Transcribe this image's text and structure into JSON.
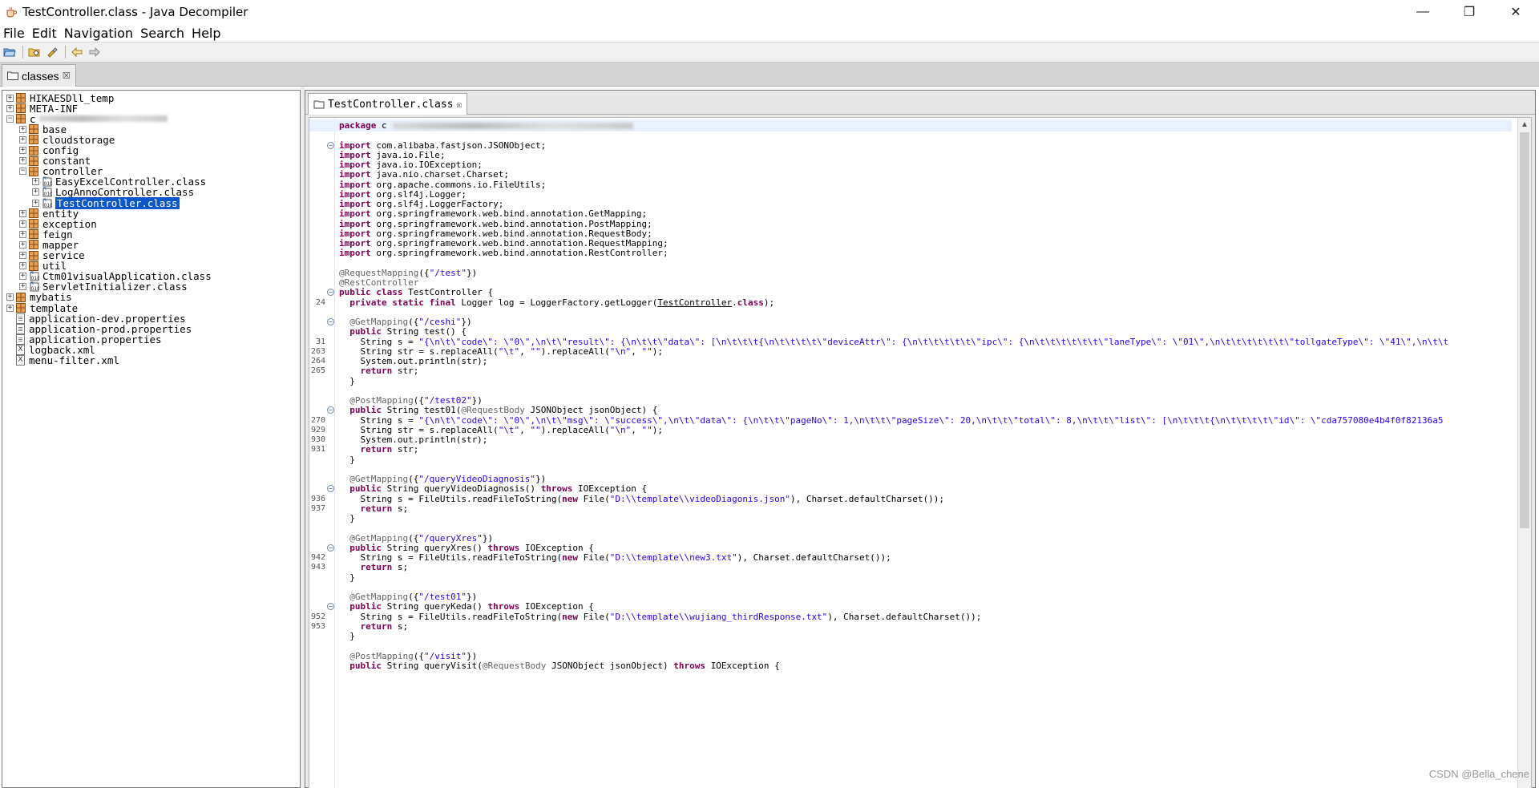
{
  "window": {
    "title": "TestController.class - Java Decompiler",
    "minimize": "—",
    "restore": "❐",
    "close": "✕"
  },
  "menu": [
    "File",
    "Edit",
    "Navigation",
    "Search",
    "Help"
  ],
  "outer_tab": {
    "label": "classes",
    "close": "☒"
  },
  "editor_tab": {
    "label": "TestController.class",
    "close": "☒"
  },
  "tree": {
    "items": [
      {
        "label": "HIKAESDll_temp",
        "indent": 0,
        "expander": "+",
        "icon": "package"
      },
      {
        "label": "META-INF",
        "indent": 0,
        "expander": "+",
        "icon": "package"
      },
      {
        "label": "c",
        "indent": 0,
        "expander": "-",
        "icon": "package",
        "redacted": true
      },
      {
        "label": "base",
        "indent": 1,
        "expander": "+",
        "icon": "package"
      },
      {
        "label": "cloudstorage",
        "indent": 1,
        "expander": "+",
        "icon": "package"
      },
      {
        "label": "config",
        "indent": 1,
        "expander": "+",
        "icon": "package"
      },
      {
        "label": "constant",
        "indent": 1,
        "expander": "+",
        "icon": "package"
      },
      {
        "label": "controller",
        "indent": 1,
        "expander": "-",
        "icon": "package"
      },
      {
        "label": "EasyExcelController.class",
        "indent": 2,
        "expander": "+",
        "icon": "class"
      },
      {
        "label": "LogAnnoController.class",
        "indent": 2,
        "expander": "+",
        "icon": "class"
      },
      {
        "label": "TestController.class",
        "indent": 2,
        "expander": "+",
        "icon": "class",
        "selected": true
      },
      {
        "label": "entity",
        "indent": 1,
        "expander": "+",
        "icon": "package"
      },
      {
        "label": "exception",
        "indent": 1,
        "expander": "+",
        "icon": "package"
      },
      {
        "label": "feign",
        "indent": 1,
        "expander": "+",
        "icon": "package"
      },
      {
        "label": "mapper",
        "indent": 1,
        "expander": "+",
        "icon": "package"
      },
      {
        "label": "service",
        "indent": 1,
        "expander": "+",
        "icon": "package"
      },
      {
        "label": "util",
        "indent": 1,
        "expander": "+",
        "icon": "package"
      },
      {
        "label": "Ctm01visualApplication.class",
        "indent": 1,
        "expander": "+",
        "icon": "class"
      },
      {
        "label": "ServletInitializer.class",
        "indent": 1,
        "expander": "+",
        "icon": "class"
      },
      {
        "label": "mybatis",
        "indent": 0,
        "expander": "+",
        "icon": "package"
      },
      {
        "label": "template",
        "indent": 0,
        "expander": "+",
        "icon": "package"
      },
      {
        "label": "application-dev.properties",
        "indent": 0,
        "expander": "",
        "icon": "file"
      },
      {
        "label": "application-prod.properties",
        "indent": 0,
        "expander": "",
        "icon": "file"
      },
      {
        "label": "application.properties",
        "indent": 0,
        "expander": "",
        "icon": "file"
      },
      {
        "label": "logback.xml",
        "indent": 0,
        "expander": "",
        "icon": "xml"
      },
      {
        "label": "menu-filter.xml",
        "indent": 0,
        "expander": "",
        "icon": "xml"
      }
    ]
  },
  "code": {
    "lines": [
      {
        "ln": "",
        "fold": "",
        "html": "<span class='kw'>package</span> c",
        "hl": true,
        "redact": true
      },
      {
        "ln": "",
        "fold": "",
        "html": ""
      },
      {
        "ln": "",
        "fold": "⊖",
        "html": "<span class='kw'>import</span> com.alibaba.fastjson.JSONObject;"
      },
      {
        "ln": "",
        "fold": "",
        "html": "<span class='kw'>import</span> java.io.File;"
      },
      {
        "ln": "",
        "fold": "",
        "html": "<span class='kw'>import</span> java.io.IOException;"
      },
      {
        "ln": "",
        "fold": "",
        "html": "<span class='kw'>import</span> java.nio.charset.Charset;"
      },
      {
        "ln": "",
        "fold": "",
        "html": "<span class='kw'>import</span> org.apache.commons.io.FileUtils;"
      },
      {
        "ln": "",
        "fold": "",
        "html": "<span class='kw'>import</span> org.slf4j.Logger;"
      },
      {
        "ln": "",
        "fold": "",
        "html": "<span class='kw'>import</span> org.slf4j.LoggerFactory;"
      },
      {
        "ln": "",
        "fold": "",
        "html": "<span class='kw'>import</span> org.springframework.web.bind.annotation.GetMapping;"
      },
      {
        "ln": "",
        "fold": "",
        "html": "<span class='kw'>import</span> org.springframework.web.bind.annotation.PostMapping;"
      },
      {
        "ln": "",
        "fold": "",
        "html": "<span class='kw'>import</span> org.springframework.web.bind.annotation.RequestBody;"
      },
      {
        "ln": "",
        "fold": "",
        "html": "<span class='kw'>import</span> org.springframework.web.bind.annotation.RequestMapping;"
      },
      {
        "ln": "",
        "fold": "",
        "html": "<span class='kw'>import</span> org.springframework.web.bind.annotation.RestController;"
      },
      {
        "ln": "",
        "fold": "",
        "html": ""
      },
      {
        "ln": "",
        "fold": "",
        "html": "<span class='ann'>@RequestMapping</span>({<span class='str'>\"/test\"</span>})"
      },
      {
        "ln": "",
        "fold": "",
        "html": "<span class='ann'>@RestController</span>"
      },
      {
        "ln": "",
        "fold": "⊖",
        "html": "<span class='kw'>public class</span> TestController {"
      },
      {
        "ln": "24",
        "fold": "",
        "html": "  <span class='kw'>private static final</span> Logger log = LoggerFactory.getLogger(<span class='ul'>TestController</span>.<span class='kw'>class</span>);"
      },
      {
        "ln": "",
        "fold": "",
        "html": ""
      },
      {
        "ln": "",
        "fold": "⊖",
        "html": "  <span class='ann'>@GetMapping</span>({<span class='str'>\"/ceshi\"</span>})"
      },
      {
        "ln": "",
        "fold": "",
        "html": "  <span class='kw'>public</span> String test() {"
      },
      {
        "ln": "31",
        "fold": "",
        "html": "    String s = <span class='str'>\"{\\n\\t\\\"code\\\": \\\"0\\\",\\n\\t\\\"result\\\": {\\n\\t\\t\\\"data\\\": [\\n\\t\\t\\t{\\n\\t\\t\\t\\t\\\"deviceAttr\\\": {\\n\\t\\t\\t\\t\\t\\\"ipc\\\": {\\n\\t\\t\\t\\t\\t\\t\\\"laneType\\\": \\\"01\\\",\\n\\t\\t\\t\\t\\t\\t\\\"tollgateType\\\": \\\"41\\\",\\n\\t\\t</span>"
      },
      {
        "ln": "263",
        "fold": "",
        "html": "    String str = s.replaceAll(<span class='str'>\"\\t\"</span>, <span class='str'>\"\"</span>).replaceAll(<span class='str'>\"\\n\"</span>, <span class='str'>\"\"</span>);"
      },
      {
        "ln": "264",
        "fold": "",
        "html": "    System.out.println(str);"
      },
      {
        "ln": "265",
        "fold": "",
        "html": "    <span class='kw'>return</span> str;"
      },
      {
        "ln": "",
        "fold": "",
        "html": "  }"
      },
      {
        "ln": "",
        "fold": "",
        "html": ""
      },
      {
        "ln": "",
        "fold": "",
        "html": "  <span class='ann'>@PostMapping</span>({<span class='str'>\"/test02\"</span>})"
      },
      {
        "ln": "",
        "fold": "⊖",
        "html": "  <span class='kw'>public</span> String test01(<span class='ann'>@RequestBody</span> JSONObject jsonObject) {"
      },
      {
        "ln": "270",
        "fold": "",
        "html": "    String s = <span class='str'>\"{\\n\\t\\\"code\\\": \\\"0\\\",\\n\\t\\\"msg\\\": \\\"success\\\",\\n\\t\\\"data\\\": {\\n\\t\\t\\\"pageNo\\\": 1,\\n\\t\\t\\\"pageSize\\\": 20,\\n\\t\\t\\\"total\\\": 8,\\n\\t\\t\\\"list\\\": [\\n\\t\\t\\t{\\n\\t\\t\\t\\t\\\"id\\\": \\\"cda757080e4b4f0f82136a5</span>"
      },
      {
        "ln": "929",
        "fold": "",
        "html": "    String str = s.replaceAll(<span class='str'>\"\\t\"</span>, <span class='str'>\"\"</span>).replaceAll(<span class='str'>\"\\n\"</span>, <span class='str'>\"\"</span>);"
      },
      {
        "ln": "930",
        "fold": "",
        "html": "    System.out.println(str);"
      },
      {
        "ln": "931",
        "fold": "",
        "html": "    <span class='kw'>return</span> str;"
      },
      {
        "ln": "",
        "fold": "",
        "html": "  }"
      },
      {
        "ln": "",
        "fold": "",
        "html": ""
      },
      {
        "ln": "",
        "fold": "",
        "html": "  <span class='ann'>@GetMapping</span>({<span class='str'>\"/queryVideoDiagnosis\"</span>})"
      },
      {
        "ln": "",
        "fold": "⊖",
        "html": "  <span class='kw'>public</span> String queryVideoDiagnosis() <span class='kw'>throws</span> IOException {"
      },
      {
        "ln": "936",
        "fold": "",
        "html": "    String s = FileUtils.readFileToString(<span class='kw'>new</span> File(<span class='str'>\"D:\\\\template\\\\videoDiagonis.json\"</span>), Charset.defaultCharset());"
      },
      {
        "ln": "937",
        "fold": "",
        "html": "    <span class='kw'>return</span> s;"
      },
      {
        "ln": "",
        "fold": "",
        "html": "  }"
      },
      {
        "ln": "",
        "fold": "",
        "html": ""
      },
      {
        "ln": "",
        "fold": "",
        "html": "  <span class='ann'>@GetMapping</span>({<span class='str'>\"/queryXres\"</span>})"
      },
      {
        "ln": "",
        "fold": "⊖",
        "html": "  <span class='kw'>public</span> String queryXres() <span class='kw'>throws</span> IOException {"
      },
      {
        "ln": "942",
        "fold": "",
        "html": "    String s = FileUtils.readFileToString(<span class='kw'>new</span> File(<span class='str'>\"D:\\\\template\\\\new3.txt\"</span>), Charset.defaultCharset());"
      },
      {
        "ln": "943",
        "fold": "",
        "html": "    <span class='kw'>return</span> s;"
      },
      {
        "ln": "",
        "fold": "",
        "html": "  }"
      },
      {
        "ln": "",
        "fold": "",
        "html": ""
      },
      {
        "ln": "",
        "fold": "",
        "html": "  <span class='ann'>@GetMapping</span>({<span class='str'>\"/test01\"</span>})"
      },
      {
        "ln": "",
        "fold": "⊖",
        "html": "  <span class='kw'>public</span> String queryKeda() <span class='kw'>throws</span> IOException {"
      },
      {
        "ln": "952",
        "fold": "",
        "html": "    String s = FileUtils.readFileToString(<span class='kw'>new</span> File(<span class='str'>\"D:\\\\template\\\\wujiang_thirdResponse.txt\"</span>), Charset.defaultCharset());"
      },
      {
        "ln": "953",
        "fold": "",
        "html": "    <span class='kw'>return</span> s;"
      },
      {
        "ln": "",
        "fold": "",
        "html": "  }"
      },
      {
        "ln": "",
        "fold": "",
        "html": ""
      },
      {
        "ln": "",
        "fold": "",
        "html": "  <span class='ann'>@PostMapping</span>({<span class='str'>\"/visit\"</span>})"
      },
      {
        "ln": "",
        "fold": "",
        "html": "  <span class='kw'>public</span> String queryVisit(<span class='ann'>@RequestBody</span> JSONObject jsonObject) <span class='kw'>throws</span> IOException {"
      }
    ]
  },
  "watermark": "CSDN @Bella_chene"
}
